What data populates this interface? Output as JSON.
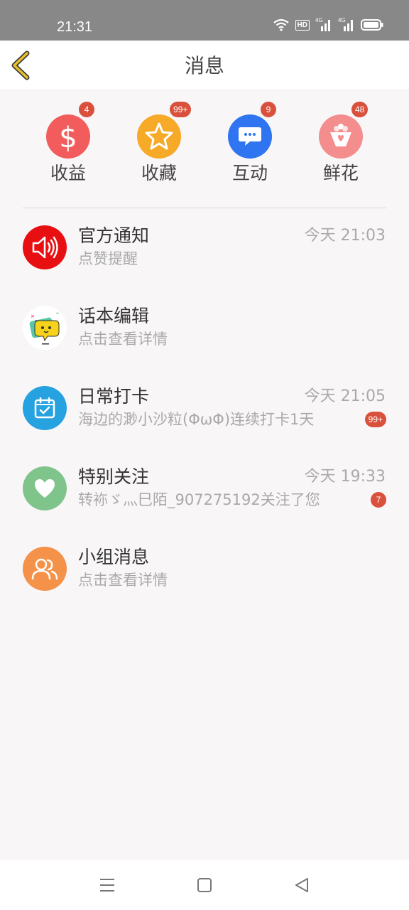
{
  "status_bar": {
    "time": "21:31",
    "hd_label": "HD",
    "signal_label_1": "4G",
    "signal_label_2": "4G",
    "icons": [
      "wifi-icon",
      "hd-icon",
      "signal-icon",
      "signal-icon",
      "battery-icon"
    ]
  },
  "header": {
    "title": "消息",
    "back_icon": "chevron-left-icon",
    "back_color": "#e8c12a"
  },
  "categories": [
    {
      "label": "收益",
      "badge": "4",
      "icon": "dollar-icon",
      "color": "#f25c5c"
    },
    {
      "label": "收藏",
      "badge": "99+",
      "icon": "star-icon",
      "color": "#f7a928"
    },
    {
      "label": "互动",
      "badge": "9",
      "icon": "chat-bubble-icon",
      "color": "#2f74f0"
    },
    {
      "label": "鲜花",
      "badge": "48",
      "icon": "flower-bouquet-icon",
      "color": "#f48d8d"
    }
  ],
  "messages": [
    {
      "title": "官方通知",
      "subtitle": "点赞提醒",
      "time": "今天 21:03",
      "badge": "",
      "icon": "speaker-icon",
      "color": "#e80f12"
    },
    {
      "title": "话本编辑",
      "subtitle": "点击查看详情",
      "time": "",
      "badge": "",
      "icon": "chat-mascot-icon",
      "color": "#ffffff"
    },
    {
      "title": "日常打卡",
      "subtitle": "海边的渺小沙粒(ΦωΦ)连续打卡1天",
      "time": "今天 21:05",
      "badge": "99+",
      "icon": "calendar-check-icon",
      "color": "#26a2e0"
    },
    {
      "title": "特别关注",
      "subtitle": "转袮ゞ灬巳陌_907275192关注了您",
      "time": "今天 19:33",
      "badge": "7",
      "icon": "heart-icon",
      "color": "#7fc48b"
    },
    {
      "title": "小组消息",
      "subtitle": "点击查看详情",
      "time": "",
      "badge": "",
      "icon": "group-users-icon",
      "color": "#f5924a"
    }
  ],
  "nav_bar": {
    "icons": [
      "menu-icon",
      "home-square-icon",
      "back-triangle-icon"
    ]
  }
}
